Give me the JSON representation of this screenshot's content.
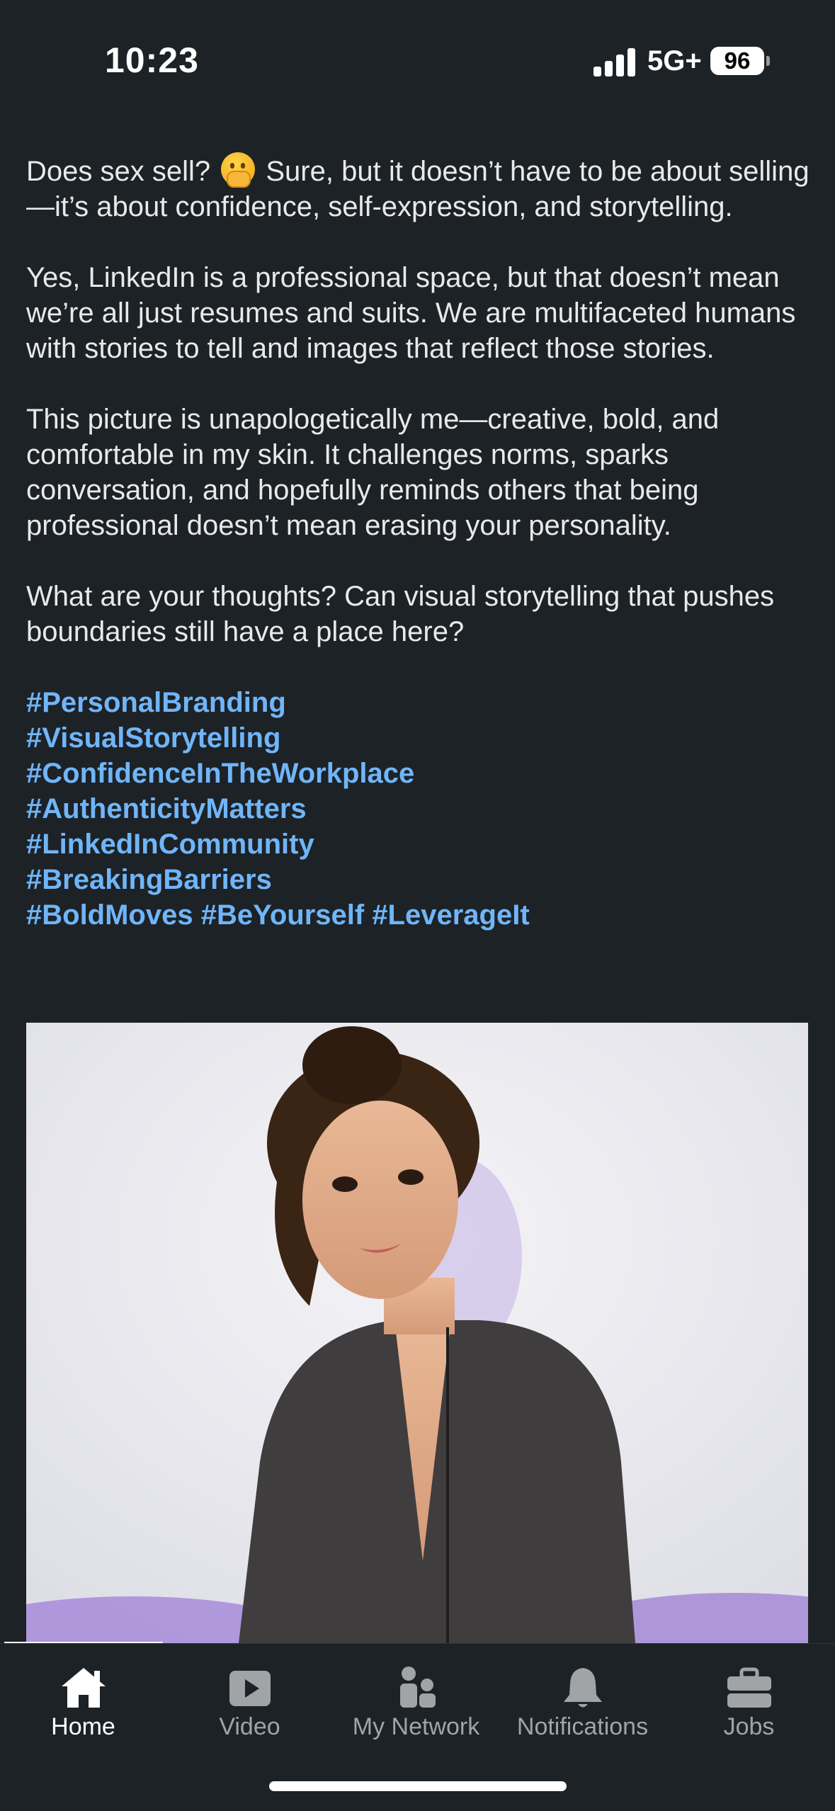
{
  "status_bar": {
    "time": "10:23",
    "network": "5G+",
    "battery": "96"
  },
  "post": {
    "paragraphs": [
      "Sure, but it doesn’t have to be about selling—it’s about confidence, self-expression, and storytelling.",
      "Yes, LinkedIn is a professional space, but that doesn’t mean we’re all just resumes and suits. We are multifaceted humans with stories to tell and images that reflect those stories.",
      "This picture is unapologetically me—creative, bold, and comfortable in my skin. It challenges norms, sparks conversation, and hopefully reminds others that being professional doesn’t mean erasing your personality.",
      "What are your thoughts? Can visual storytelling that pushes boundaries still have a place here?"
    ],
    "opening_question": "Does sex sell?",
    "emoji": "face-with-hand-over-mouth-emoji",
    "hashtags": [
      "#PersonalBranding",
      "#VisualStorytelling",
      "#ConfidenceInTheWorkplace",
      "#AuthenticityMatters",
      "#LinkedInCommunity",
      "#BreakingBarriers",
      "#BoldMoves",
      "#BeYourself",
      "#LeverageIt"
    ],
    "hashtag_color": "#70b5f9"
  },
  "nav": {
    "items": [
      {
        "label": "Home",
        "icon": "home-icon",
        "active": true
      },
      {
        "label": "Video",
        "icon": "video-play-icon",
        "active": false
      },
      {
        "label": "My Network",
        "icon": "people-icon",
        "active": false
      },
      {
        "label": "Notifications",
        "icon": "bell-icon",
        "active": false
      },
      {
        "label": "Jobs",
        "icon": "briefcase-icon",
        "active": false
      }
    ]
  },
  "colors": {
    "background": "#1d2226",
    "text": "#e9e9ea",
    "link": "#70b5f9",
    "nav_inactive": "#a0a4a7"
  }
}
